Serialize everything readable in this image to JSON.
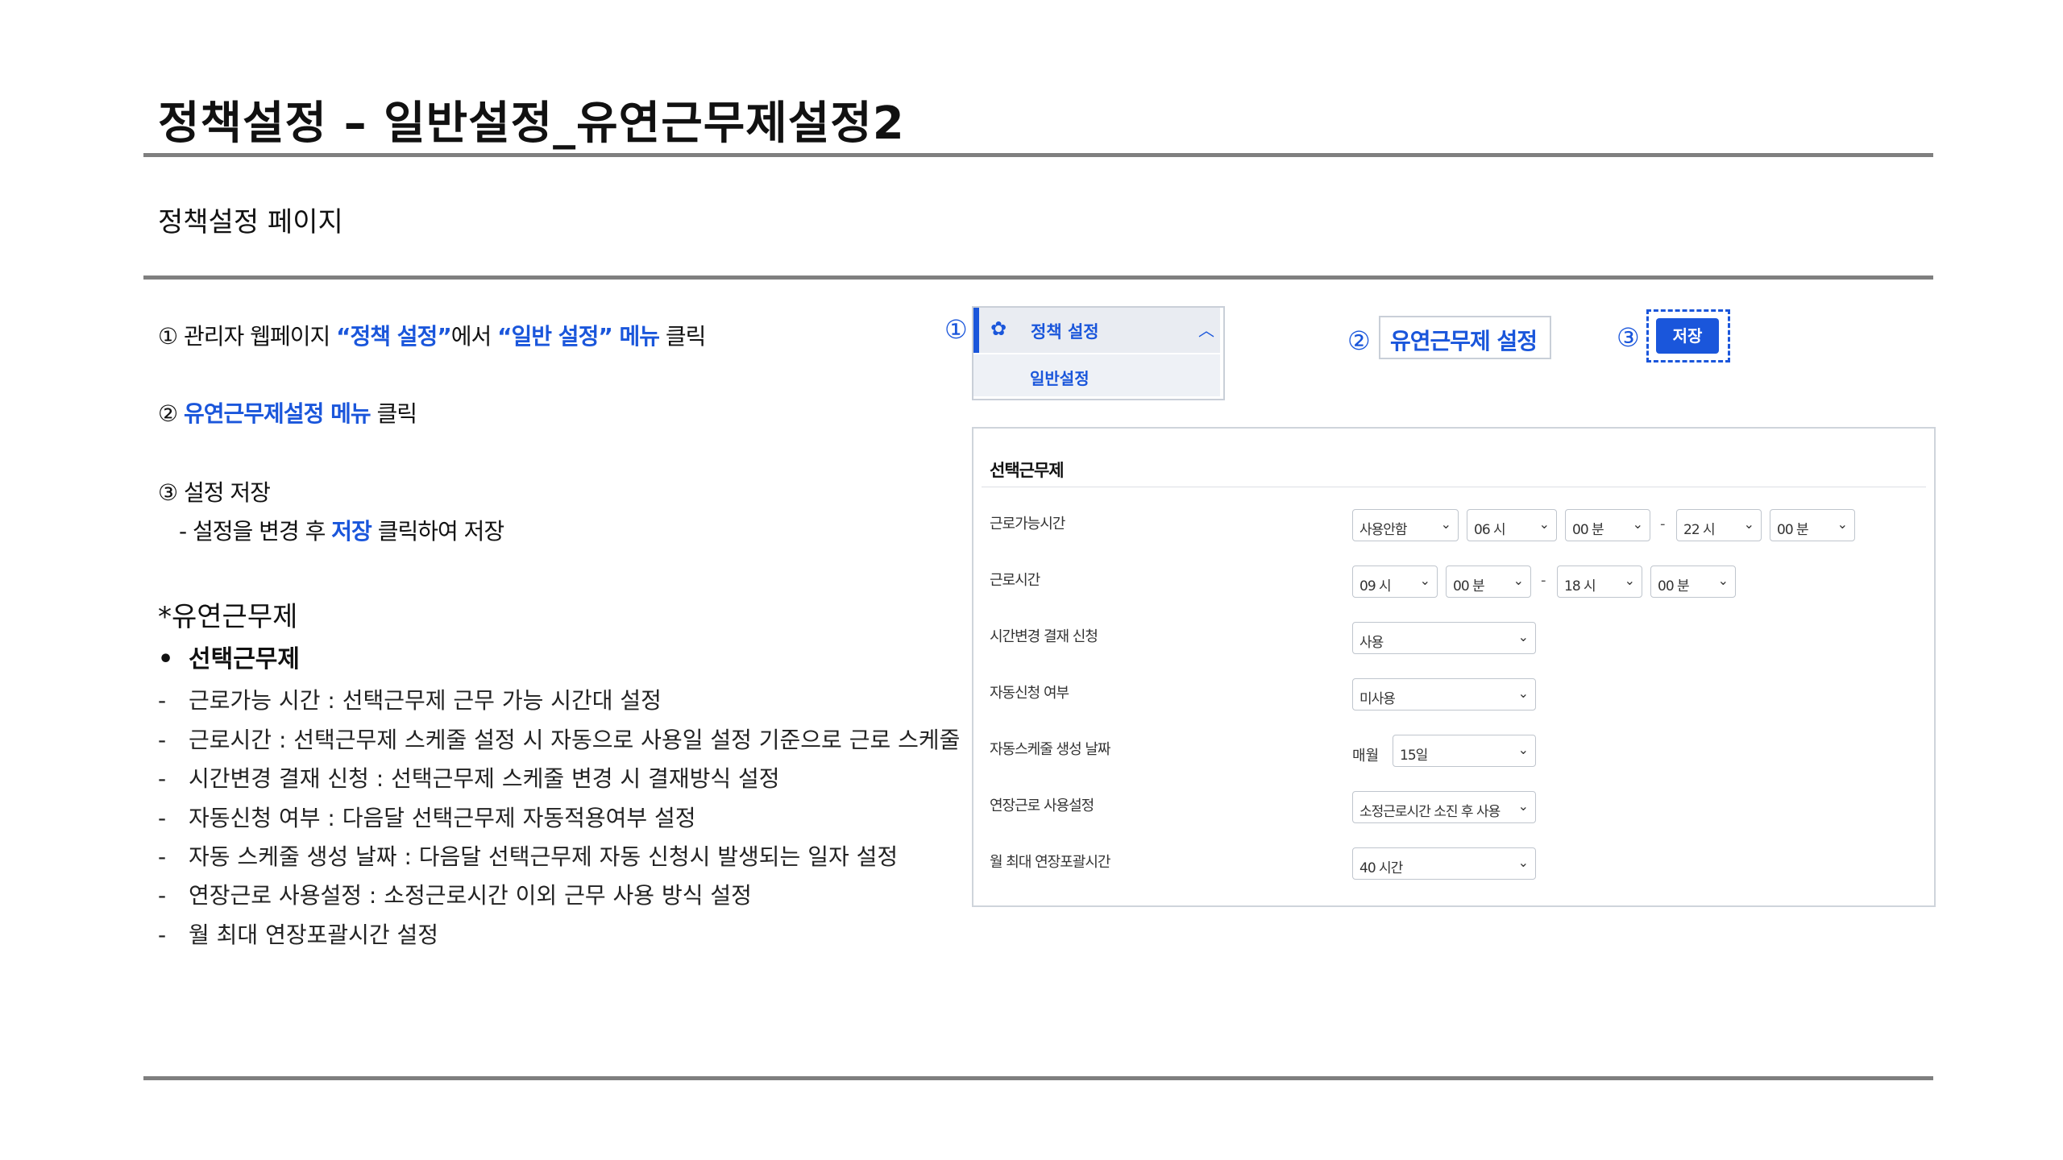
{
  "title": "정책설정 – 일반설정_유연근무제설정2",
  "subtitle": "정책설정 페이지",
  "steps": {
    "s1_prefix": "① 관리자 웹페이지 ",
    "s1_hl1": "“정책 설정”",
    "s1_mid": "에서 ",
    "s1_hl2": "“일반 설정” 메뉴",
    "s1_suffix": " 클릭",
    "s2_prefix": "② ",
    "s2_hl": "유연근무제설정 메뉴",
    "s2_suffix": " 클릭",
    "s3": "③ 설정 저장",
    "s3_sub_prefix": "- 설정을 변경 후 ",
    "s3_sub_hl": "저장",
    "s3_sub_suffix": " 클릭하여 저장"
  },
  "section": {
    "title": "*유연근무제",
    "bullet_mark": "•",
    "bullet": "선택근무제",
    "dash_mark": "-",
    "items": [
      "근로가능 시간 : 선택근무제 근무 가능 시간대 설정",
      "근로시간 : 선택근무제 스케줄 설정 시 자동으로 사용일 설정 기준으로 근로 스케줄",
      "시간변경 결재 신청 : 선택근무제 스케줄 변경 시 결재방식 설정",
      "자동신청 여부 : 다음달 선택근무제 자동적용여부 설정",
      "자동 스케줄 생성 날짜 : 다음달 선택근무제 자동 신청시 발생되는 일자 설정",
      "연장근로 사용설정 : 소정근로시간 이외 근무 사용 방식 설정",
      "월 최대 연장포괄시간 설정"
    ]
  },
  "callouts": {
    "c1": "①",
    "c2": "②",
    "c3": "③"
  },
  "menu": {
    "gear_icon": "gear-icon",
    "header": "정책 설정",
    "sub": "일반설정"
  },
  "tab": {
    "label": "유연근무제 설정"
  },
  "save": {
    "label": "저장"
  },
  "panel": {
    "title": "선택근무제",
    "rows": [
      {
        "label": "근로가능시간"
      },
      {
        "label": "근로시간"
      },
      {
        "label": "시간변경 결재 신청"
      },
      {
        "label": "자동신청 여부"
      },
      {
        "label": "자동스케줄 생성 날짜"
      },
      {
        "label": "연장근로 사용설정"
      },
      {
        "label": "월 최대 연장포괄시간"
      }
    ],
    "r1": [
      "사용안함",
      "06 시",
      "00 분",
      "-",
      "22 시",
      "00 분"
    ],
    "r2": [
      "09 시",
      "00 분",
      "-",
      "18 시",
      "00 분"
    ],
    "r3": "사용",
    "r4": "미사용",
    "r5_prefix": "매월",
    "r5": "15일",
    "r6": "소정근로시간 소진 후 사용",
    "r7": "40 시간",
    "chevron": "⌄"
  },
  "colors": {
    "accent": "#1a56db",
    "rule": "#7f7f7f"
  }
}
